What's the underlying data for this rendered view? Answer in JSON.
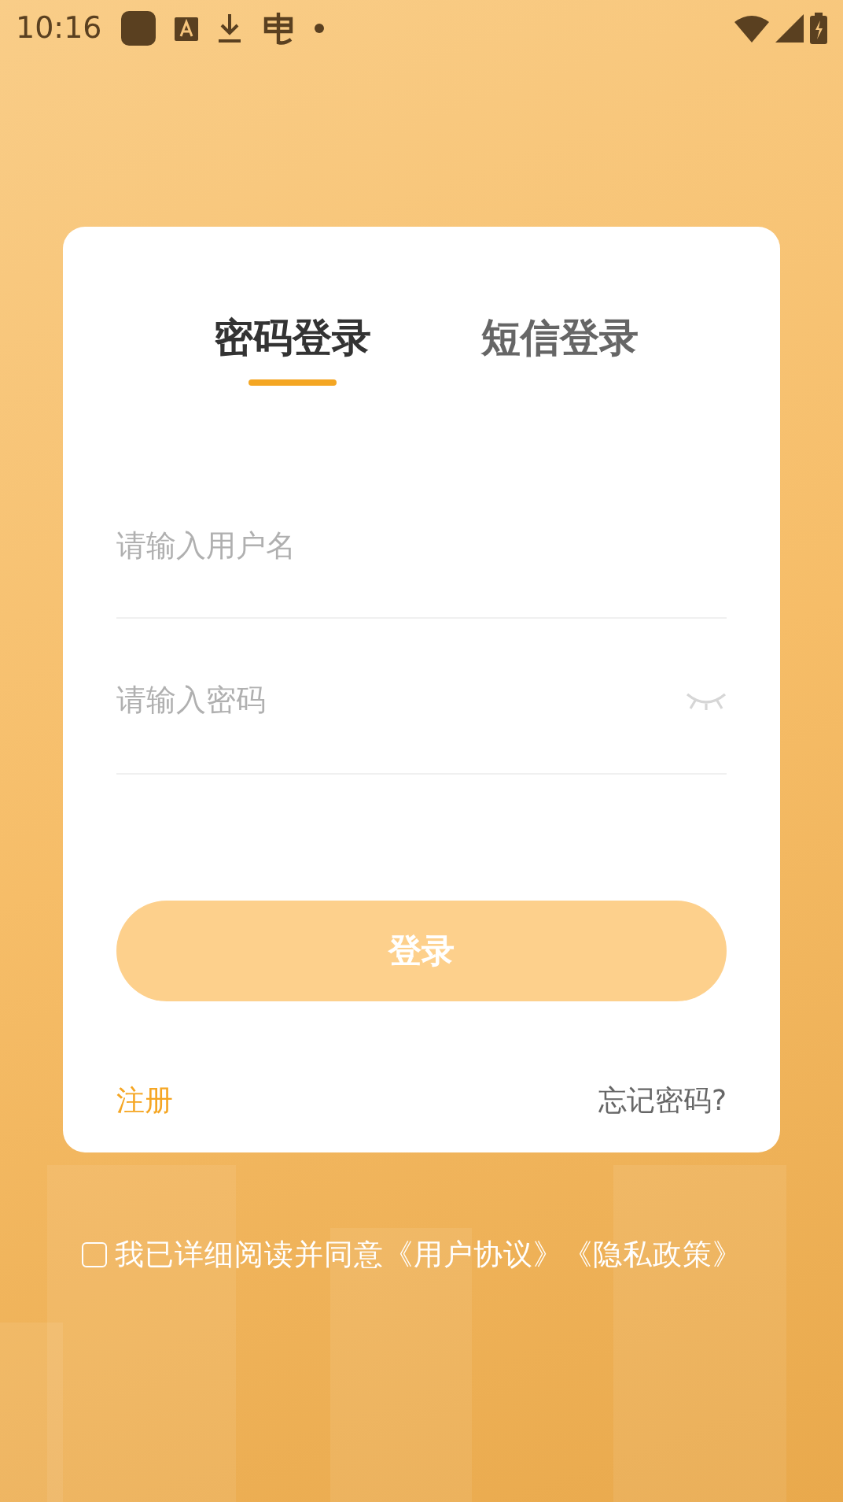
{
  "status_bar": {
    "time": "10:16"
  },
  "tabs": [
    {
      "label": "密码登录",
      "selected": true
    },
    {
      "label": "短信登录",
      "selected": false
    }
  ],
  "fields": [
    {
      "kind": "text",
      "placeholder": "请输入用户名"
    },
    {
      "kind": "password",
      "placeholder": "请输入密码"
    }
  ],
  "login_button": {
    "label": "登录",
    "disabled": true
  },
  "register_link": "注册",
  "forgot_link": "忘记密码?",
  "agreement": {
    "checked": false,
    "text": "我已详细阅读并同意",
    "links": [
      "《用户协议》",
      "《隐私政策》"
    ]
  }
}
